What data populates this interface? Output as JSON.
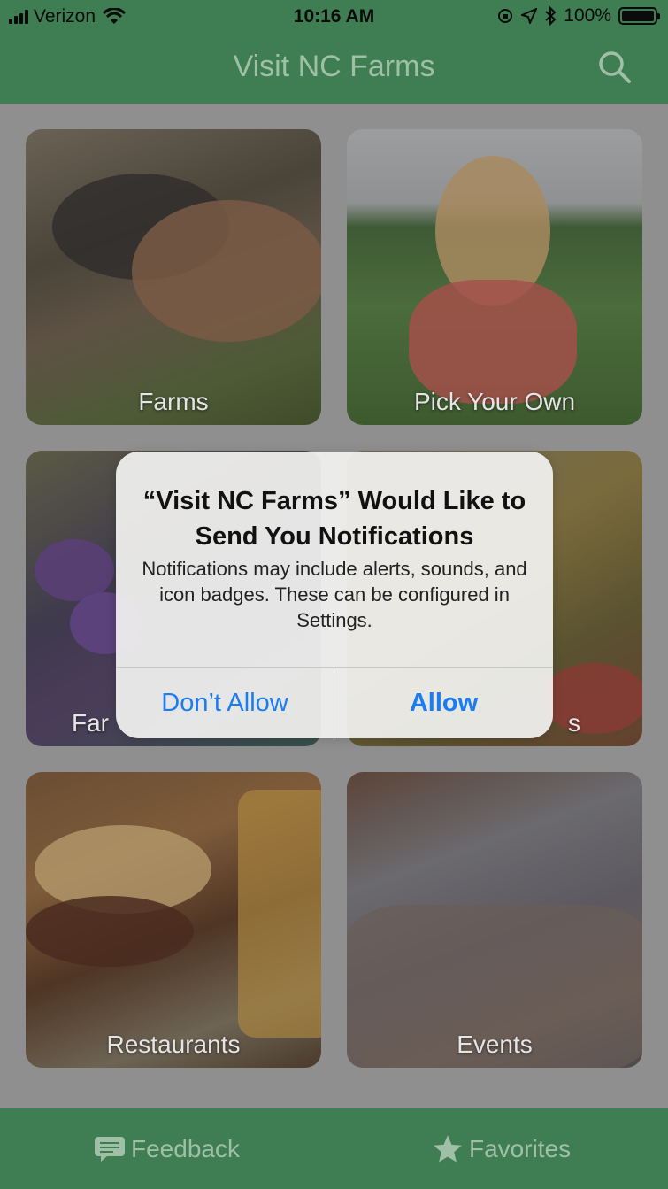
{
  "status_bar": {
    "carrier": "Verizon",
    "time": "10:16 AM",
    "battery": "100%",
    "battery_level": 1.0
  },
  "nav": {
    "title": "Visit NC Farms",
    "search_icon": "search-icon"
  },
  "tiles": [
    {
      "label": "Farms"
    },
    {
      "label": "Pick Your Own"
    },
    {
      "label": "Far"
    },
    {
      "label": "s"
    },
    {
      "label": "Restaurants"
    },
    {
      "label": "Events"
    }
  ],
  "alert": {
    "title": "“Visit NC Farms” Would Like to Send You Notifications",
    "message": "Notifications may include alerts, sounds, and icon badges. These can be configured in Settings.",
    "deny_label": "Don’t Allow",
    "allow_label": "Allow"
  },
  "tab_bar": {
    "feedback_label": "Feedback",
    "feedback_icon": "chat-bubble-icon",
    "favorites_label": "Favorites",
    "favorites_icon": "star-icon"
  },
  "colors": {
    "brand_green": "#3f7d52",
    "accent_blue": "#1a7cf0"
  }
}
